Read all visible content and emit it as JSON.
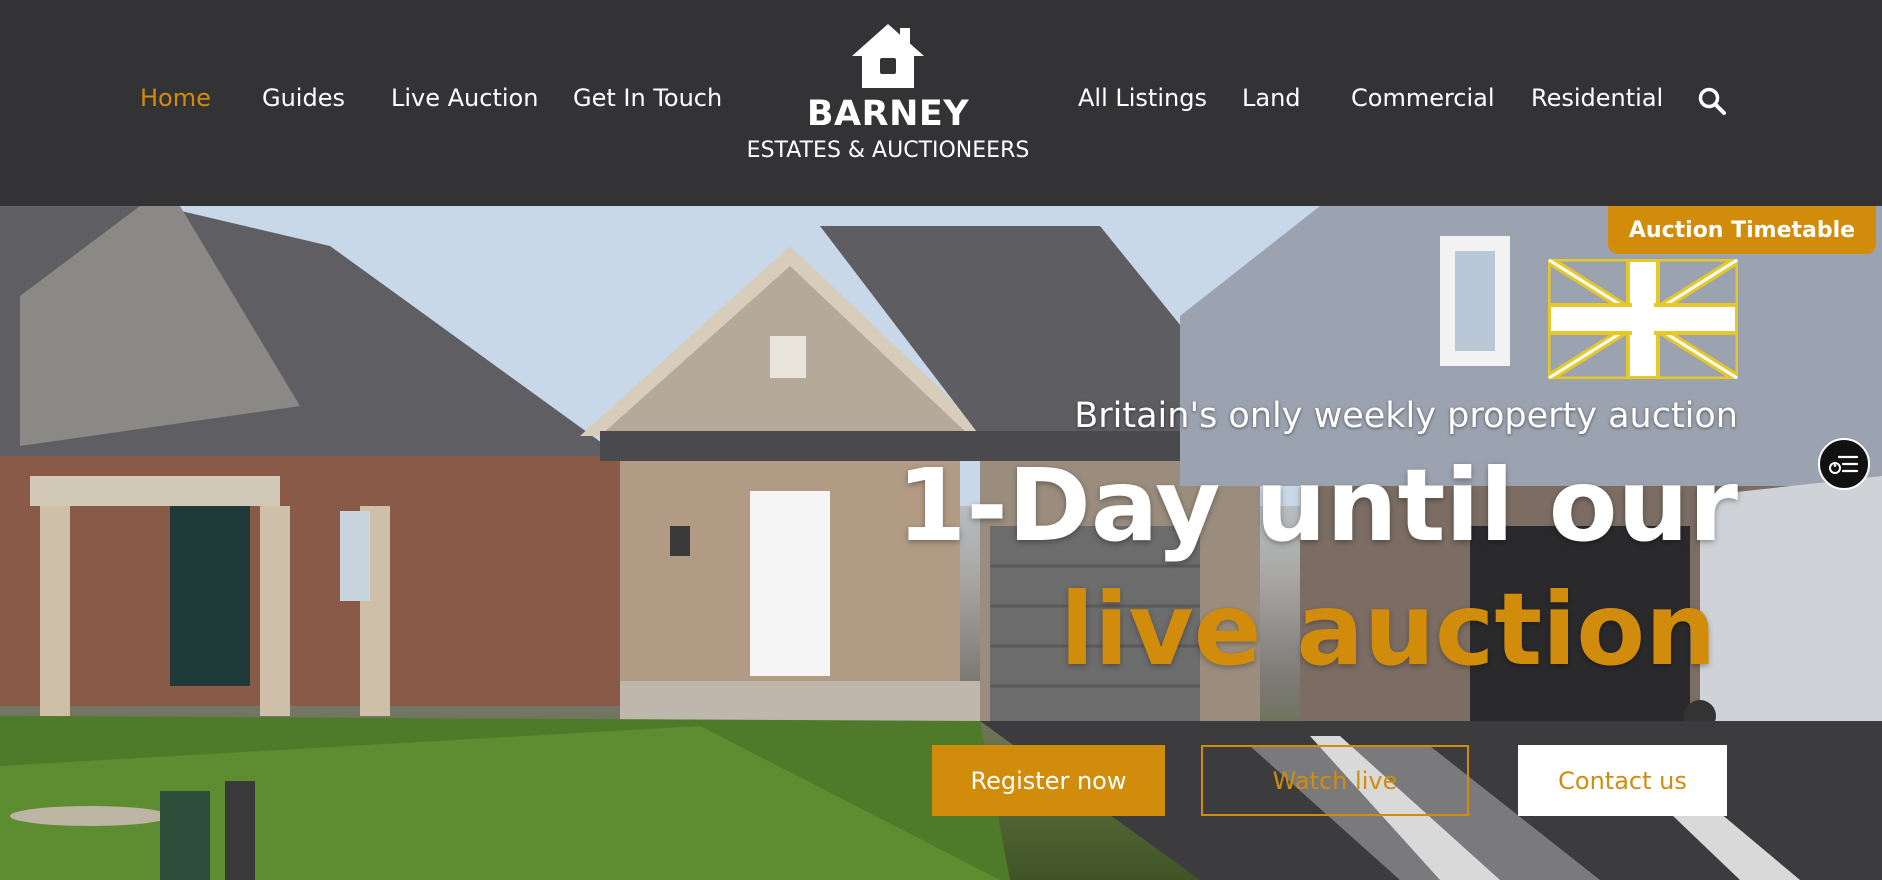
{
  "brand": {
    "name": "BARNEY",
    "tagline": "ESTATES & AUCTIONEERS"
  },
  "nav_left": [
    {
      "label": "Home",
      "active": true
    },
    {
      "label": "Guides"
    },
    {
      "label": "Live Auction"
    },
    {
      "label": "Get In Touch"
    }
  ],
  "nav_right": [
    {
      "label": "All Listings"
    },
    {
      "label": "Land"
    },
    {
      "label": "Commercial"
    },
    {
      "label": "Residential"
    }
  ],
  "icons": {
    "logo": "house-icon",
    "search": "search-icon",
    "flag": "union-jack-flag-icon",
    "widget": "accessibility-menu-icon"
  },
  "hero": {
    "timetable_label": "Auction Timetable",
    "subtitle": "Britain's only weekly property auction",
    "title_line1": "1-Day until our",
    "title_line2": "live auction",
    "buttons": {
      "register": "Register now",
      "watch": "Watch live",
      "contact": "Contact us"
    }
  },
  "colors": {
    "accent": "#d18c0c",
    "header_bg": "#333235",
    "text_light": "#ffffff"
  }
}
